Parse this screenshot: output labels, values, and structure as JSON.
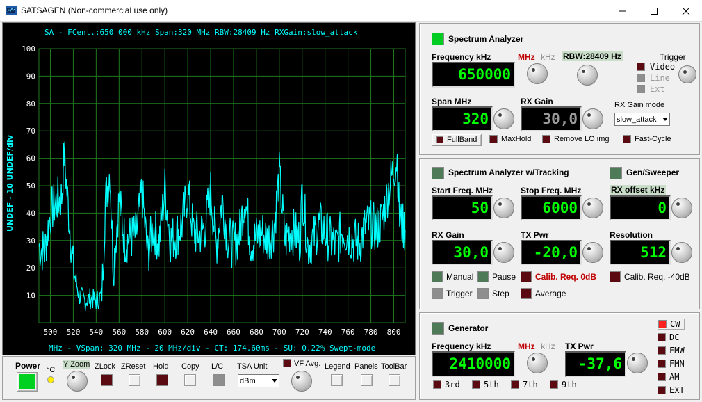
{
  "window": {
    "title": "SATSAGEN (Non-commercial use only)"
  },
  "scope": {
    "header": "SA - FCent.:650 000 kHz Span:320 MHz RBW:28409 Hz RXGain:slow_attack",
    "footer": "MHz - VSpan: 320 MHz - 20 MHz/div - CT: 174.60ms - SU: 0.22% Swept-mode",
    "ylabel": "UNDEF - 10 UNDEF/div",
    "trace_color": "#00ffff",
    "grid_color": "#1f7a1f"
  },
  "chart_data": {
    "type": "line",
    "x_ticks": [
      "500",
      "520",
      "540",
      "560",
      "580",
      "600",
      "620",
      "640",
      "660",
      "680",
      "700",
      "720",
      "740",
      "760",
      "780",
      "800"
    ],
    "y_ticks": [
      "10",
      "20",
      "30",
      "40",
      "50",
      "60",
      "70",
      "80",
      "90",
      "100"
    ],
    "xlim": [
      490,
      810
    ],
    "ylim": [
      0,
      100
    ],
    "series": [
      {
        "x": [
          490,
          495,
          500,
          505,
          510,
          512,
          515,
          520,
          525,
          530,
          535,
          540,
          545,
          548,
          552,
          555,
          560,
          565,
          570,
          575,
          580,
          585,
          590,
          595,
          600,
          605,
          610,
          615,
          620,
          625,
          630,
          635,
          640,
          645,
          650,
          655,
          660,
          665,
          670,
          675,
          680,
          685,
          690,
          695,
          698,
          700,
          705,
          710,
          715,
          718,
          720,
          725,
          730,
          735,
          740,
          745,
          750,
          755,
          760,
          765,
          770,
          775,
          780,
          785,
          790,
          795,
          800,
          803,
          805,
          808,
          810
        ],
        "y": [
          28,
          26,
          40,
          44,
          46,
          62,
          45,
          20,
          10,
          8,
          9,
          8,
          10,
          44,
          56,
          20,
          45,
          30,
          31,
          32,
          48,
          25,
          35,
          29,
          49,
          30,
          32,
          36,
          48,
          33,
          32,
          35,
          48,
          28,
          45,
          31,
          28,
          32,
          46,
          29,
          31,
          33,
          30,
          34,
          45,
          54,
          30,
          34,
          32,
          30,
          48,
          28,
          31,
          36,
          33,
          30,
          28,
          34,
          32,
          30,
          29,
          35,
          36,
          34,
          38,
          48,
          56,
          60,
          38,
          35,
          34
        ]
      }
    ]
  },
  "bottombar": {
    "power_label": "Power",
    "celsius": "°C",
    "yzoom": "Y Zoom",
    "zlock": "ZLock",
    "zreset": "ZReset",
    "hold": "Hold",
    "copy": "Copy",
    "lc": "L/C",
    "tsa_unit": "TSA Unit",
    "tsa_unit_value": "dBm",
    "vf_avg": "VF Avg.",
    "legend": "Legend",
    "panels": "Panels",
    "toolbar": "ToolBar"
  },
  "sa": {
    "title": "Spectrum Analyzer",
    "freq_label": "Frequency kHz",
    "mhz": "MHz",
    "khz": "kHz",
    "rbw": "RBW:28409 Hz",
    "trigger": "Trigger",
    "trig_video": "Video",
    "trig_line": "Line",
    "trig_ext": "Ext",
    "freq_value": "650000",
    "span_label": "Span MHz",
    "span_value": "320",
    "rxgain_label": "RX Gain",
    "rxgain_value": "30,0",
    "rxgain_mode_label": "RX Gain mode",
    "rxgain_mode_value": "slow_attack",
    "fullband": "FullBand",
    "maxhold": "MaxHold",
    "remove_lo": "Remove LO img",
    "fast_cycle": "Fast-Cycle"
  },
  "tracking": {
    "title": "Spectrum Analyzer w/Tracking",
    "gen_sweeper": "Gen/Sweeper",
    "start_label": "Start Freq. MHz",
    "start_value": "50",
    "stop_label": "Stop Freq. MHz",
    "stop_value": "6000",
    "rx_offset_label": "RX offset kHz",
    "rx_offset_value": "0",
    "rxgain_label": "RX Gain",
    "rxgain_value": "30,0",
    "txpwr_label": "TX Pwr",
    "txpwr_value": "-20,0",
    "resolution_label": "Resolution",
    "resolution_value": "512",
    "manual": "Manual",
    "pause": "Pause",
    "calib_0db": "Calib. Req. 0dB",
    "calib_40db": "Calib. Req. -40dB",
    "trigger": "Trigger",
    "step": "Step",
    "average": "Average"
  },
  "generator": {
    "title": "Generator",
    "freq_label": "Frequency kHz",
    "mhz": "MHz",
    "khz": "kHz",
    "txpwr_label": "TX Pwr",
    "freq_value": "2410000",
    "txpwr_value": "-37,6",
    "h3": "3rd",
    "h5": "5th",
    "h7": "7th",
    "h9": "9th",
    "modes": [
      "CW",
      "DC",
      "FMW",
      "FMN",
      "AM",
      "EXT"
    ]
  }
}
